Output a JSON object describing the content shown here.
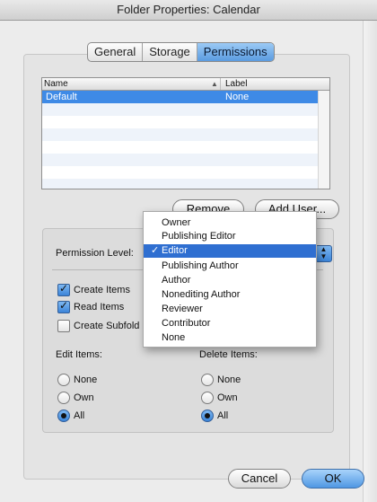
{
  "window": {
    "title": "Folder Properties: Calendar"
  },
  "tabs": [
    {
      "label": "General",
      "active": false
    },
    {
      "label": "Storage",
      "active": false
    },
    {
      "label": "Permissions",
      "active": true
    }
  ],
  "table": {
    "columns": {
      "name": "Name",
      "label": "Label"
    },
    "rows": [
      {
        "name": "Default",
        "label": "None",
        "selected": true
      }
    ]
  },
  "buttons": {
    "remove": "Remove",
    "add_user": "Add User...",
    "cancel": "Cancel",
    "ok": "OK"
  },
  "permission": {
    "level_label": "Permission Level:",
    "selected_level": "Editor",
    "menu_items": [
      "Owner",
      "Publishing Editor",
      "Editor",
      "Publishing Author",
      "Author",
      "Nonediting Author",
      "Reviewer",
      "Contributor",
      "None"
    ],
    "selected_index": 2
  },
  "checkboxes": [
    {
      "label": "Create Items",
      "checked": true
    },
    {
      "label": "Read Items",
      "checked": true
    },
    {
      "label": "Create Subfold",
      "checked": false
    }
  ],
  "edit_items": {
    "label": "Edit Items:",
    "options": [
      "None",
      "Own",
      "All"
    ],
    "selected": "All"
  },
  "delete_items": {
    "label": "Delete Items:",
    "options": [
      "None",
      "Own",
      "All"
    ],
    "selected": "All"
  },
  "colors": {
    "selection": "#3e8ae6",
    "menu_selection": "#2f6fd1",
    "accent": "#4f97e3"
  }
}
